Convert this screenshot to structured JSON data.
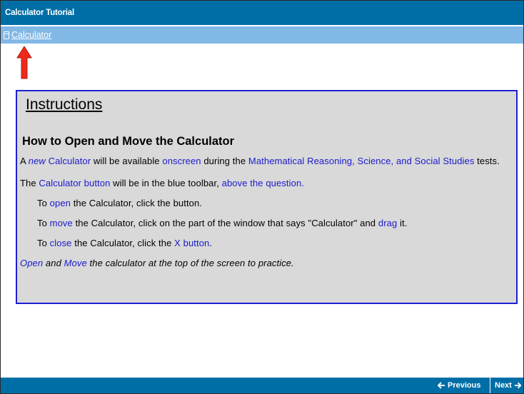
{
  "window": {
    "title": "Calculator Tutorial"
  },
  "toolbar": {
    "calculator_label": "Calculator"
  },
  "instructions": {
    "heading": "Instructions",
    "subheading": "How to Open and Move the Calculator",
    "p1": {
      "t1": "A ",
      "t2": "new",
      "t3": " ",
      "t4": "Calculator",
      "t5": " will be available ",
      "t6": "onscreen",
      "t7": " during the ",
      "t8": "Mathematical Reasoning, Science, and Social Studies",
      "t9": " tests."
    },
    "p2": {
      "t1": "The ",
      "t2": "Calculator button",
      "t3": " will be in the blue toolbar, ",
      "t4": "above the question."
    },
    "p3": {
      "t1": "To ",
      "t2": "open",
      "t3": " the Calculator, click the button."
    },
    "p4": {
      "t1": "To ",
      "t2": "move",
      "t3": " the Calculator, click on the part of the window that says \"Calculator\" and ",
      "t4": "drag",
      "t5": " it."
    },
    "p5": {
      "t1": "To ",
      "t2": "close",
      "t3": " the Calculator, click the ",
      "t4": "X button",
      "t5": "."
    },
    "p6": {
      "t1": "Open",
      "t2": " and ",
      "t3": "Move",
      "t4": " the calculator at the top of the screen to practice."
    }
  },
  "nav": {
    "previous_label": "Previous",
    "next_label": "Next",
    "previous_icon": "arrow-left-icon",
    "next_icon": "arrow-right-icon"
  },
  "colors": {
    "titlebar": "#006ea6",
    "toolbar": "#82b8e6",
    "panel_background": "#d9d9d9",
    "panel_border": "#1f1fd0",
    "link": "#1a1acd",
    "arrow": "#ee2a1b"
  }
}
